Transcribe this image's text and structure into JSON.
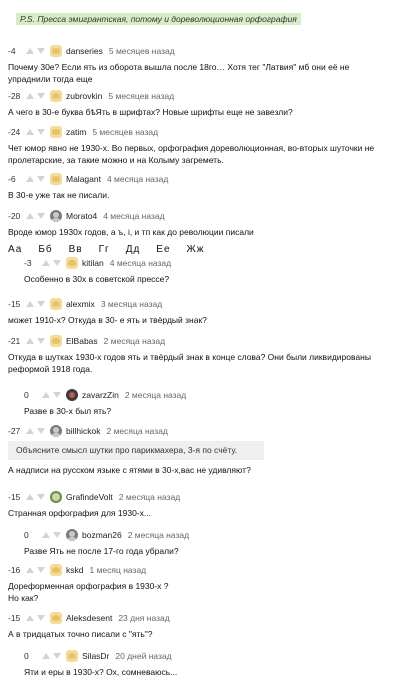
{
  "caption": "P.S. Пресса эмигрантская, потому и дореволюционная орфография",
  "alphabet": [
    "Аа",
    "Бб",
    "Вв",
    "Гг",
    "Дд",
    "Ее",
    "Жж"
  ],
  "comments": [
    {
      "score": "-4",
      "author": "danseries",
      "date": "5 месяцев назад",
      "avatar": "troll",
      "text": "Почему 30е? Если ять из оборота вышла после 18го… Хотя тег \"Латвия\" мб они её не упраднили тогда еще"
    },
    {
      "score": "-28",
      "author": "zubrovkin",
      "date": "5 месяцев назад",
      "avatar": "troll",
      "text": "А чего в 30-е буква бѣЯть в шрифтах? Новые шрифты еще не завезли?"
    },
    {
      "score": "-24",
      "author": "zatim",
      "date": "5 месяцев назад",
      "avatar": "troll",
      "text": "Чет юмор явно не 1930-х. Во первых, орфография дореволюционная, во-вторых шуточки не пролетарские, за такие можно и на Колыму загреметь."
    },
    {
      "score": "-6",
      "author": "Malagant",
      "date": "4 месяца назад",
      "avatar": "troll",
      "text": "В 30-е уже так не писали."
    },
    {
      "score": "-20",
      "author": "Morato4",
      "date": "4 месяца назад",
      "avatar": "photo",
      "text": "Вроде юмор 1930х годов, а ъ, і, и тп как до революции писали"
    },
    {
      "score": "-3",
      "author": "kitilan",
      "date": "4 месяца назад",
      "avatar": "troll",
      "text": "Особенно в 30х в советской прессе?"
    },
    {
      "score": "-15",
      "author": "alexmix",
      "date": "3 месяца назад",
      "avatar": "troll",
      "text": "может 1910-х? Откуда в 30- е  ять и твёрдый знак?"
    },
    {
      "score": "-21",
      "author": "ElBabas",
      "date": "2 месяца назад",
      "avatar": "troll",
      "text": "Откуда в шутках 1930-х годов ять и твёрдый знак в конце слова? Они были ликвидированы реформой 1918 года."
    },
    {
      "score": "0",
      "author": "zavarzZin",
      "date": "2 месяца назад",
      "avatar": "dark",
      "text": "Разве в 30-х был ять?"
    },
    {
      "score": "-27",
      "author": "billhickok",
      "date": "2 месяца назад",
      "avatar": "photo",
      "quote": "Объясните смысл шутки про парикмахера, 3-я по счёту.",
      "text": "А надписи на русском языке с ятями в 30-х,вас не удивляют?"
    },
    {
      "score": "-15",
      "author": "GrafindeVolt",
      "date": "2 месяца назад",
      "avatar": "green",
      "text": "Странная орфография для 1930-х..."
    },
    {
      "score": "0",
      "author": "bozman26",
      "date": "2 месяца назад",
      "avatar": "photo",
      "text": "Разве Ять не после 17-го года убрали?"
    },
    {
      "score": "-16",
      "author": "kskd",
      "date": "1 месяц назад",
      "avatar": "troll",
      "text": "Дореформенная орфография в 1930-х ?\nНо как?"
    },
    {
      "score": "-15",
      "author": "Aleksdesent",
      "date": "23 дня назад",
      "avatar": "troll",
      "text": "А в тридцатых точно писали с \"ять\"?"
    },
    {
      "score": "0",
      "author": "SilasDr",
      "date": "20 дней назад",
      "avatar": "troll",
      "text": "Яти и еры в 1930-х? Ох, сомневаюсь..."
    }
  ]
}
